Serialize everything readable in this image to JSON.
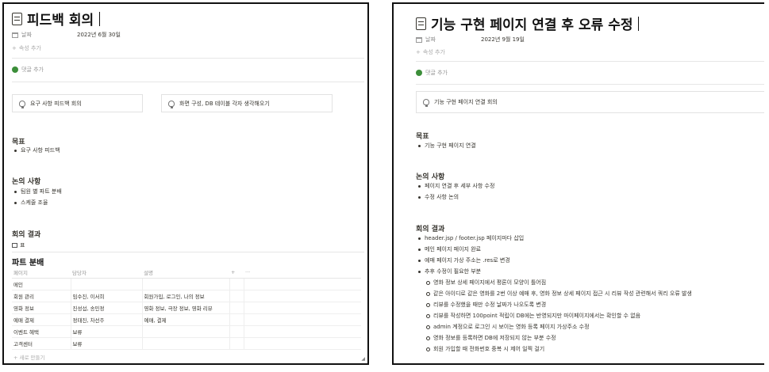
{
  "left": {
    "title": "피드백 회의",
    "date_label": "날짜",
    "date_value": "2022년 6월 30일",
    "add_property": "속성 추가",
    "add_comment": "댓글 추가",
    "callouts": [
      "요구 사항 피드백 회의",
      "화면 구성, DB 테이블 각자 생각해오기"
    ],
    "goal_heading": "목표",
    "goal_items": [
      "요구 사항 피드백"
    ],
    "discussion_heading": "논의 사항",
    "discussion_items": [
      "팀원 별 파트 분배",
      "스케줄 조율"
    ],
    "result_heading": "회의 결과",
    "db_tab": "표",
    "db_title": "파트 분배",
    "db_columns": [
      "페이지",
      "담당자",
      "설명",
      "+",
      "···"
    ],
    "db_rows": [
      [
        "메인",
        "",
        ""
      ],
      [
        "회원 관리",
        "임수진, 이서희",
        "회원가입, 로그인, 나의 정보"
      ],
      [
        "영화 정보",
        "진성섭, 송민정",
        "영화 정보, 극장 정보, 영화 리뷰"
      ],
      [
        "예매 결제",
        "정태진, 차선주",
        "예매, 결제"
      ],
      [
        "이벤트 혜택",
        "보류",
        ""
      ],
      [
        "고객센터",
        "보류",
        ""
      ]
    ],
    "new_row": "+ 새로 만들기"
  },
  "right": {
    "title": "기능 구현 페이지 연결 후 오류 수정",
    "date_label": "날짜",
    "date_value": "2022년 9월 19일",
    "add_property": "속성 추가",
    "add_comment": "댓글 추가",
    "callout": "기능 구현 페이지 연결 회의",
    "goal_heading": "목표",
    "goal_items": [
      "기능 구현 페이지 연결"
    ],
    "discussion_heading": "논의 사항",
    "discussion_items": [
      "페이지 연결 후 세부 사항 수정",
      "수정 사항 논의"
    ],
    "result_heading": "회의 결과",
    "result_items": [
      "header.jsp / footer.jsp 페이지마다 삽입",
      "메인 페이지 페이지 완료",
      "예매 페이지 가상 주소는 .res로 변경",
      "추후 수정이 필요한 부분"
    ],
    "sub_items": [
      "영화 정보 상세 페이지에서 평론이 모양이 틀어짐",
      "같은 아이디로 같은 영화를 2번 이상 예매 후, 영화 정보 상세 페이지 접근 시 리뷰 작성 관련해서 쿼리 오류 발생",
      "리뷰를 수정했을 때만 수정 날짜가 나오도록 변경",
      "리뷰를 작성하면 100point 적립이 DB에는 반영되지만 마이페이지에서는 확인할 수 없음",
      "admin 계정으로 로그인 시 보이는 영화 등록 페이지 가상주소 수정",
      "영화 정보를 등록하면 DB에 저장되지 않는 부분 수정",
      "회원 가입할 때 전화번호 중복 시 제어 일찍 걸기"
    ]
  }
}
